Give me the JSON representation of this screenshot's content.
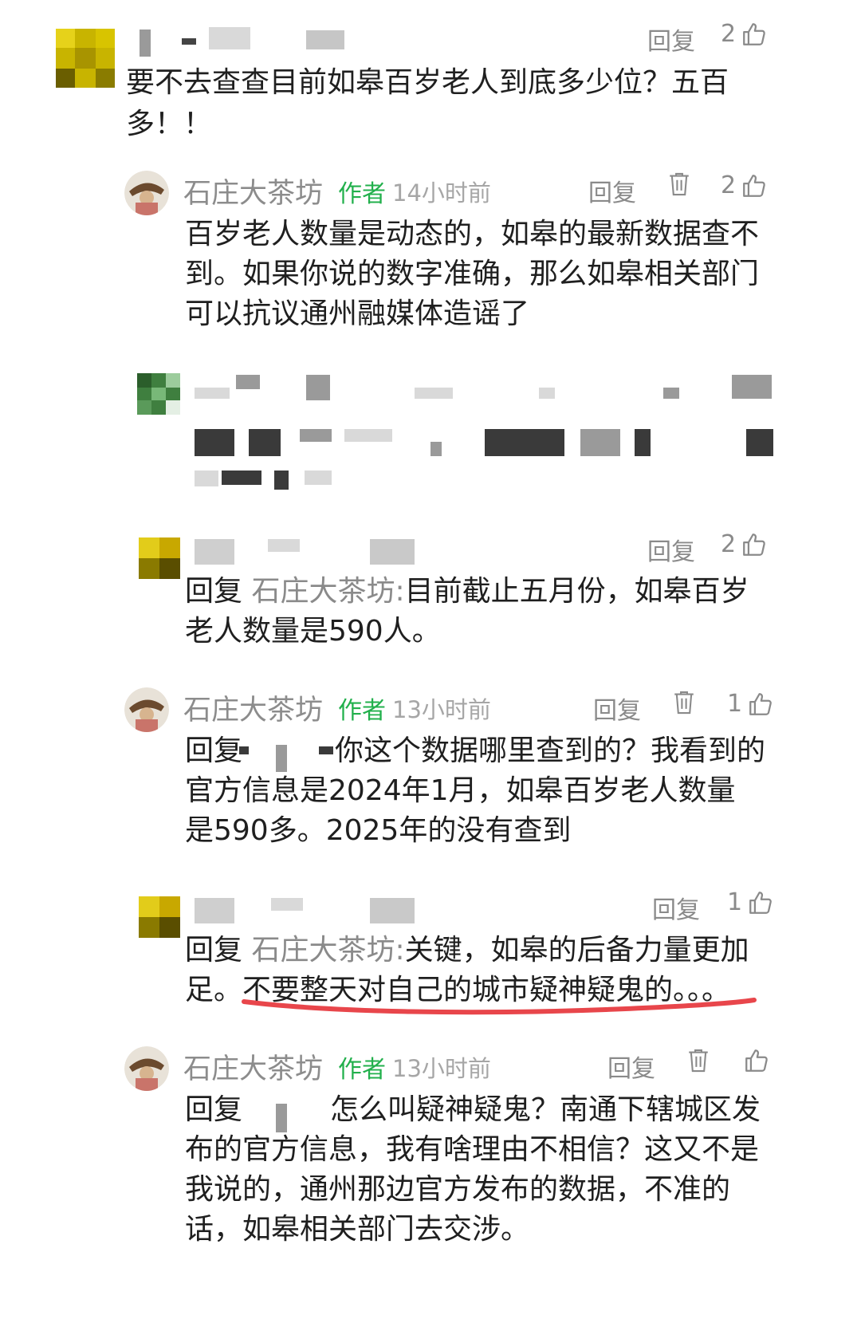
{
  "thread": {
    "reply_label": "回复",
    "author_badge": "作者",
    "comments": [
      {
        "id": "c1",
        "likes": "2",
        "text": "要不去查查目前如皋百岁老人到底多少位？五百多！！"
      },
      {
        "id": "r1",
        "name": "石庄大茶坊",
        "time": "14小时前",
        "likes": "2",
        "text_line1": "百岁老人数量是动态的，如皋的最新数据查不",
        "text_line2": "到。如果你说的数字准确，那么如皋相关部门",
        "text_line3": "可以抗议通州融媒体造谣了"
      },
      {
        "id": "r3",
        "likes": "2",
        "quote_prefix": "回复",
        "quote_name": "石庄大茶坊:",
        "text_tail": "目前截止五月份，如皋百岁",
        "text_line2": "老人数量是590人。"
      },
      {
        "id": "r4",
        "name": "石庄大茶坊",
        "time": "13小时前",
        "likes": "1",
        "text_line1a": "回复",
        "text_line1b": "你这个数据哪里查到的？我看到的",
        "text_line2": "官方信息是2024年1月，如皋百岁老人数量",
        "text_line3": "是590多。2025年的没有查到"
      },
      {
        "id": "r5",
        "likes": "1",
        "quote_prefix": "回复",
        "quote_name": "石庄大茶坊:",
        "text_tail": "关键，如皋的后备力量更加",
        "text_line2a": "足。",
        "text_line2b": "不要整天对自己的城市疑神疑鬼的。。。"
      },
      {
        "id": "r6",
        "name": "石庄大茶坊",
        "time": "13小时前",
        "text_line1a": "回复",
        "text_line1b": "怎么叫疑神疑鬼？南通下辖城区发",
        "text_line2": "布的官方信息，我有啥理由不相信？这又不是",
        "text_line3": "我说的，通州那边官方发布的数据，不准的",
        "text_line4": "话，如皋相关部门去交涉。"
      }
    ]
  },
  "colors": {
    "author_green": "#22b04c",
    "underline_red": "#e8464b"
  },
  "icons": [
    "thumb-up-icon",
    "trash-icon",
    "avatar-image"
  ]
}
